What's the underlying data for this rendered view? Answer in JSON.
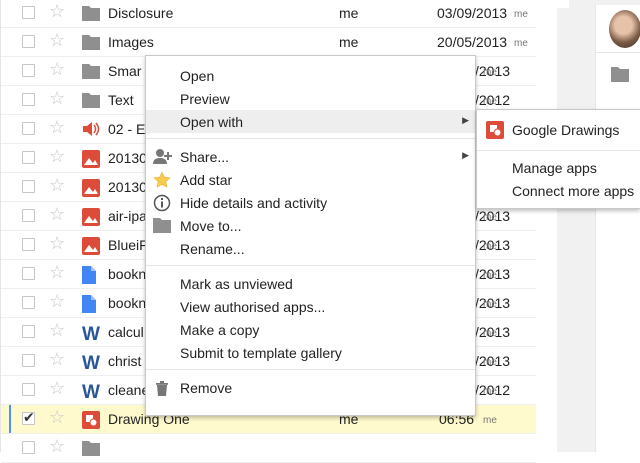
{
  "file_rows": [
    {
      "name": "Disclosure",
      "icon": "folder-icon",
      "owner": "me",
      "date": "03/09/2013",
      "by": "me",
      "checked": false
    },
    {
      "name": "Images",
      "icon": "folder-icon",
      "owner": "me",
      "date": "20/05/2013",
      "by": "me",
      "checked": false
    },
    {
      "name": "Smar",
      "icon": "folder-icon",
      "owner": "",
      "date": "/2013",
      "by": "me",
      "checked": false
    },
    {
      "name": "Text",
      "icon": "folder-icon",
      "owner": "",
      "date": "/2012",
      "by": "me",
      "checked": false
    },
    {
      "name": "02 - E",
      "icon": "audio-file-icon",
      "owner": "",
      "date": "",
      "by": "",
      "checked": false
    },
    {
      "name": "20130",
      "icon": "image-file-icon",
      "owner": "",
      "date": "",
      "by": "",
      "checked": false
    },
    {
      "name": "20130",
      "icon": "image-file-icon",
      "owner": "",
      "date": "",
      "by": "",
      "checked": false
    },
    {
      "name": "air-ipa",
      "icon": "image-file-icon",
      "owner": "",
      "date": "/2013",
      "by": "me",
      "checked": false
    },
    {
      "name": "BlueiF",
      "icon": "image-file-icon",
      "owner": "",
      "date": "/2013",
      "by": "me",
      "checked": false
    },
    {
      "name": "bookn",
      "icon": "document-file-icon",
      "owner": "",
      "date": "/2013",
      "by": "me",
      "checked": false
    },
    {
      "name": "bookn",
      "icon": "document-file-icon",
      "owner": "",
      "date": "/2013",
      "by": "me",
      "checked": false
    },
    {
      "name": "calcul",
      "icon": "word-file-icon",
      "owner": "",
      "date": "/2013",
      "by": "me",
      "checked": false
    },
    {
      "name": "christ",
      "icon": "word-file-icon",
      "owner": "",
      "date": "/2013",
      "by": "me",
      "checked": false
    },
    {
      "name": "cleane",
      "icon": "word-file-icon",
      "owner": "",
      "date": "/2012",
      "by": "me",
      "checked": false
    },
    {
      "name": "Drawing One",
      "icon": "drawing-file-icon",
      "owner": "me",
      "date": "06:56",
      "by": "me",
      "checked": true
    },
    {
      "name": "",
      "icon": "folder-icon",
      "owner": "",
      "date": "",
      "by": "",
      "checked": false
    }
  ],
  "context_menu": {
    "groups": [
      [
        {
          "label": "Open",
          "icon": "",
          "submenu": false,
          "highlighted": false
        },
        {
          "label": "Preview",
          "icon": "",
          "submenu": false,
          "highlighted": false
        },
        {
          "label": "Open with",
          "icon": "",
          "submenu": true,
          "highlighted": true
        }
      ],
      [
        {
          "label": "Share...",
          "icon": "share-person-icon",
          "submenu": true,
          "highlighted": false
        },
        {
          "label": "Add star",
          "icon": "star-icon",
          "submenu": false,
          "highlighted": false
        },
        {
          "label": "Hide details and activity",
          "icon": "info-icon",
          "submenu": false,
          "highlighted": false
        },
        {
          "label": "Move to...",
          "icon": "folder-icon",
          "submenu": false,
          "highlighted": false
        },
        {
          "label": "Rename...",
          "icon": "",
          "submenu": false,
          "highlighted": false
        }
      ],
      [
        {
          "label": "Mark as unviewed",
          "icon": "",
          "submenu": false,
          "highlighted": false
        },
        {
          "label": "View authorised apps...",
          "icon": "",
          "submenu": false,
          "highlighted": false
        },
        {
          "label": "Make a copy",
          "icon": "",
          "submenu": false,
          "highlighted": false
        },
        {
          "label": "Submit to template gallery",
          "icon": "",
          "submenu": false,
          "highlighted": false
        }
      ],
      [
        {
          "label": "Remove",
          "icon": "trash-icon",
          "submenu": false,
          "highlighted": false
        }
      ]
    ]
  },
  "open_with_submenu": {
    "app": {
      "label": "Google Drawings",
      "icon": "google-drawings-icon"
    },
    "actions": [
      "Manage apps",
      "Connect more apps"
    ]
  },
  "colors": {
    "selected_row": "#fffacd",
    "menu_highlight": "#eeeeee",
    "folder": "#8f8f8f",
    "image_red": "#dd4b39",
    "doc_blue": "#4285f4",
    "word_blue": "#2a5699"
  }
}
